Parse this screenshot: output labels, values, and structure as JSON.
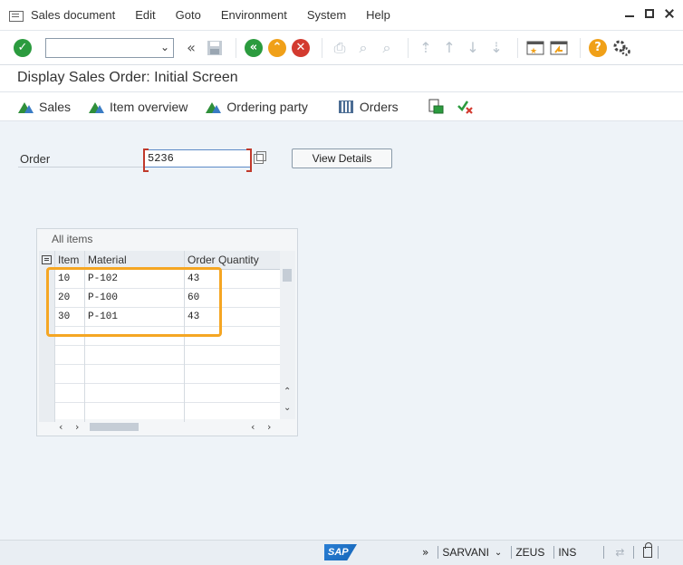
{
  "menubar": {
    "items": [
      "Sales document",
      "Edit",
      "Goto",
      "Environment",
      "System",
      "Help"
    ]
  },
  "toolbar": {
    "command_value": "",
    "icons": [
      "enter-icon",
      "back-icon",
      "exit-icon",
      "cancel-icon",
      "print-icon",
      "find-icon",
      "find-next-icon",
      "first-page-icon",
      "previous-page-icon",
      "next-page-icon",
      "last-page-icon",
      "create-session-icon",
      "shortcut-icon",
      "help-icon",
      "customize-icon"
    ]
  },
  "title": "Display Sales Order: Initial Screen",
  "app_toolbar": {
    "buttons": [
      {
        "label": "Sales",
        "icon": "mountain-icon"
      },
      {
        "label": "Item overview",
        "icon": "mountain-icon"
      },
      {
        "label": "Ordering party",
        "icon": "mountain-icon"
      },
      {
        "label": "Orders",
        "icon": "orders-icon"
      }
    ]
  },
  "form": {
    "order_label": "Order",
    "order_value": "5236",
    "view_details_label": "View Details"
  },
  "table": {
    "caption": "All items",
    "columns": [
      "Item",
      "Material",
      "Order Quantity"
    ],
    "rows": [
      [
        "10",
        "P-102",
        "43"
      ],
      [
        "20",
        "P-100",
        "60"
      ],
      [
        "30",
        "P-101",
        "43"
      ]
    ]
  },
  "statusbar": {
    "logo": "SAP",
    "user": "SARVANI",
    "system": "ZEUS",
    "mode": "INS"
  },
  "colors": {
    "highlight": "#f5a623",
    "enter": "#2b9b3e",
    "required_marker": "#c0392b"
  }
}
